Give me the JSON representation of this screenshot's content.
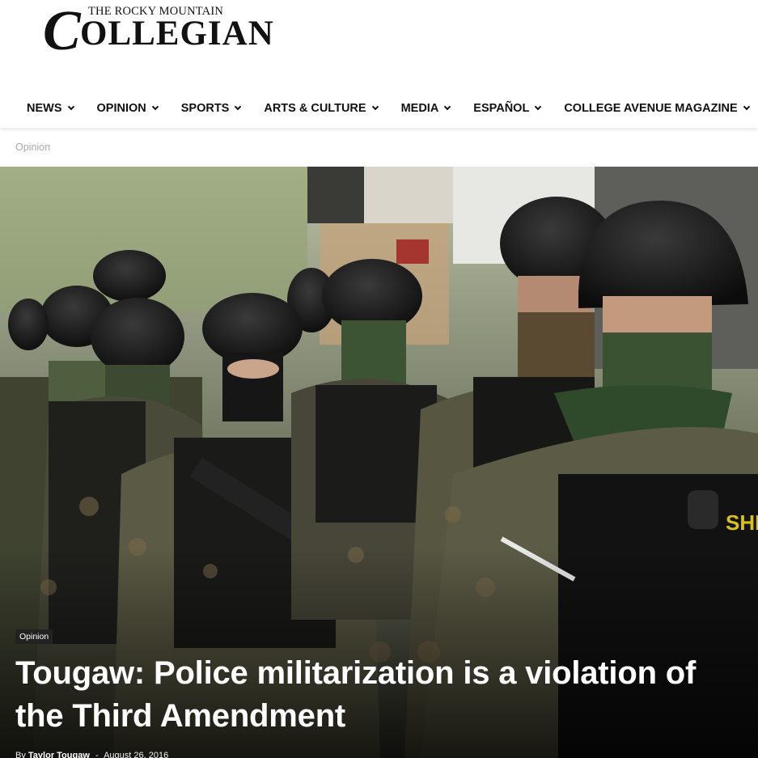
{
  "site": {
    "logo_top": "THE ROCKY MOUNTAIN",
    "logo_c": "C",
    "logo_main": "OLLEGIAN"
  },
  "nav": {
    "items": [
      {
        "label": "NEWS"
      },
      {
        "label": "OPINION"
      },
      {
        "label": "SPORTS"
      },
      {
        "label": "ARTS & CULTURE"
      },
      {
        "label": "MEDIA"
      },
      {
        "label": "ESPAÑOL"
      },
      {
        "label": "COLLEGE AVENUE MAGAZINE"
      }
    ]
  },
  "breadcrumb": "Opinion",
  "article": {
    "category": "Opinion",
    "title": "Tougaw: Police militarization is a violation of the Third Amendment",
    "by": "By",
    "author": "Taylor Tougaw",
    "separator": "-",
    "date": "August 26, 2016"
  },
  "hero_image": {
    "badge_text": "SHE"
  },
  "colors": {
    "nav_text": "#111111",
    "breadcrumb": "#aaaaaa",
    "tag_bg": "#222222",
    "title_text": "#ffffff"
  }
}
